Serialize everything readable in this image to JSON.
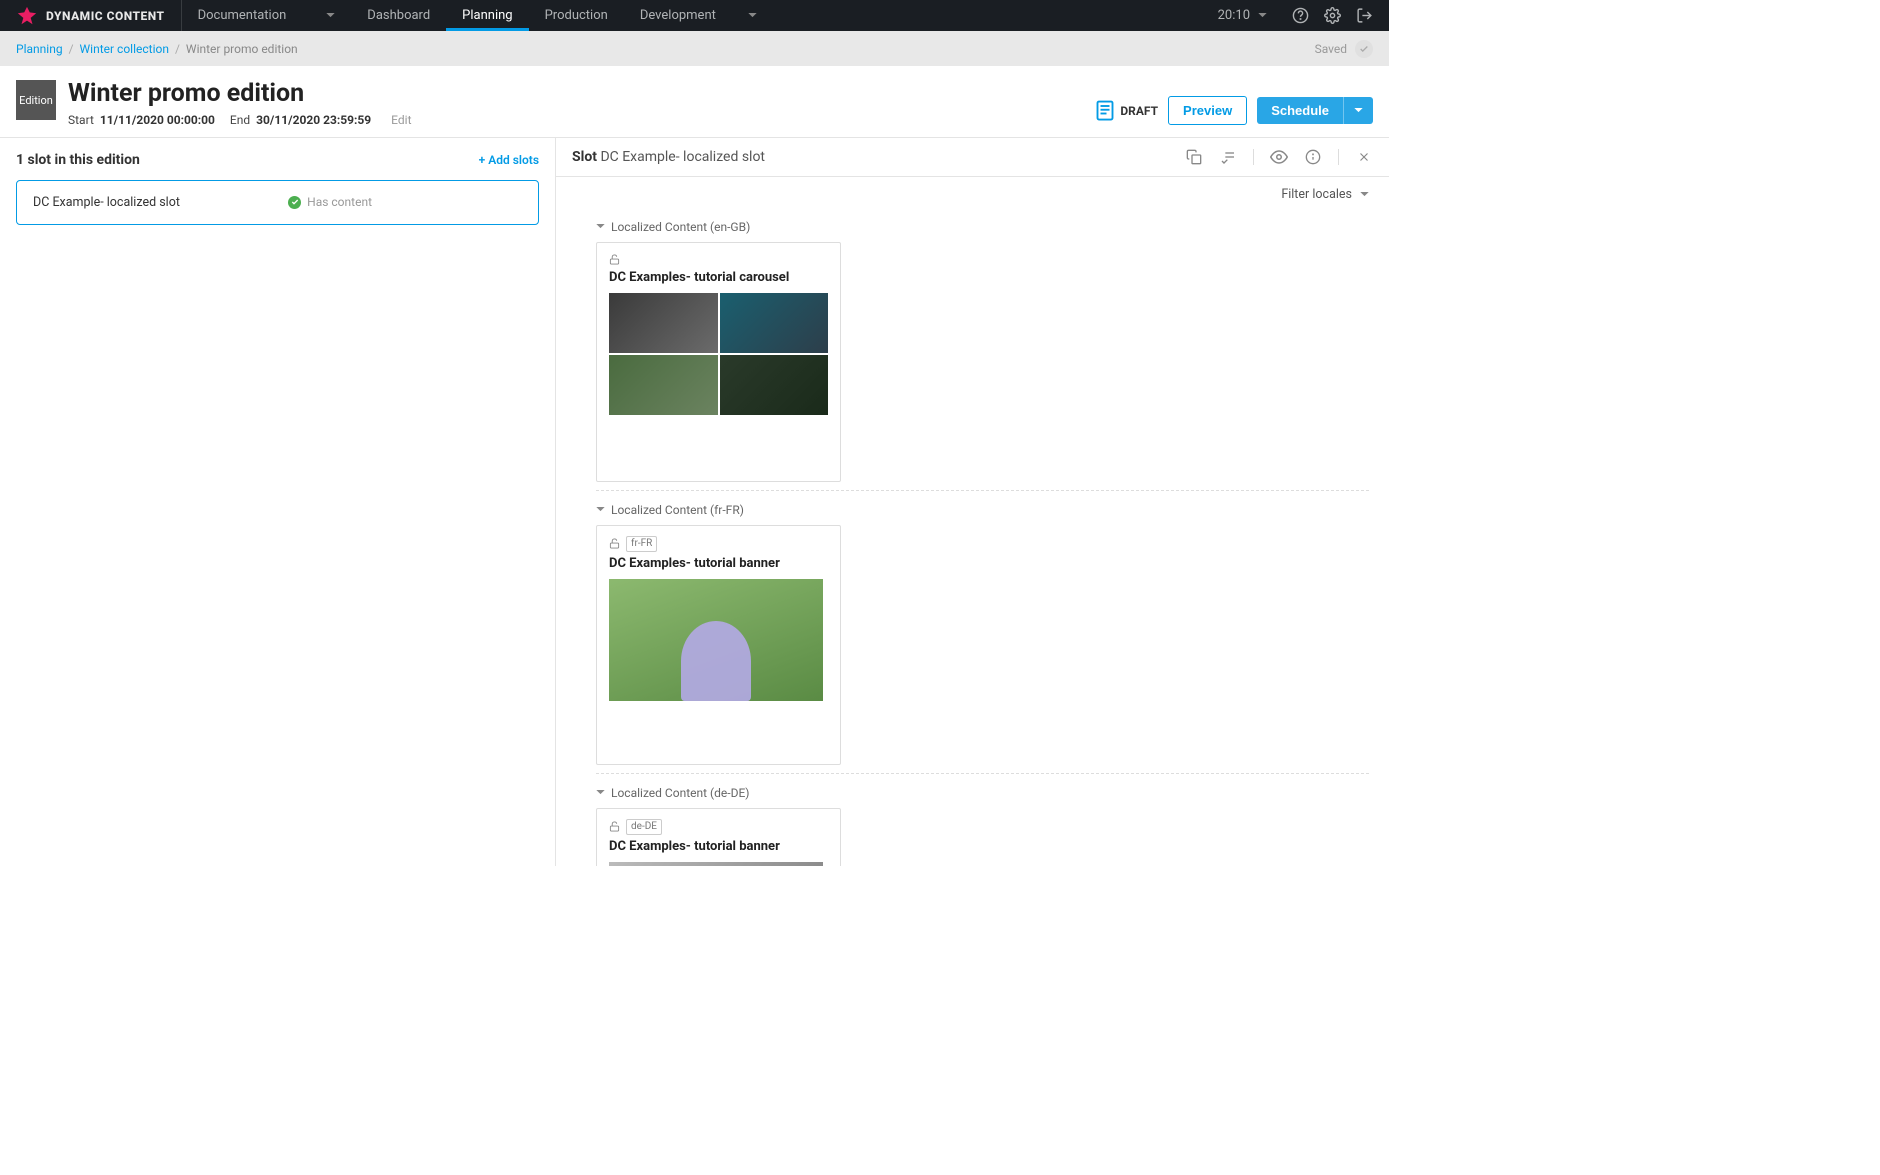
{
  "brand": "DYNAMIC CONTENT",
  "nav": {
    "dropdown": "Documentation",
    "tabs": [
      "Dashboard",
      "Planning",
      "Production",
      "Development"
    ],
    "active_tab": "Planning",
    "time": "20:10"
  },
  "breadcrumb": {
    "items": [
      "Planning",
      "Winter collection",
      "Winter promo edition"
    ],
    "saved_label": "Saved"
  },
  "edition": {
    "chip": "Edition",
    "title": "Winter promo edition",
    "start_label": "Start",
    "start_value": "11/11/2020 00:00:00",
    "end_label": "End",
    "end_value": "30/11/2020 23:59:59",
    "edit_label": "Edit",
    "status": "DRAFT",
    "preview_btn": "Preview",
    "schedule_btn": "Schedule"
  },
  "slots": {
    "heading": "1 slot in this edition",
    "add_label": "+ Add slots",
    "items": [
      {
        "name": "DC Example- localized slot",
        "status": "Has content"
      }
    ]
  },
  "slot_detail": {
    "label": "Slot",
    "name": "DC Example- localized slot",
    "filter_label": "Filter locales",
    "sections": [
      {
        "label": "Localized Content (en-GB)",
        "card_title": "DC Examples- tutorial carousel",
        "locale_tag": "",
        "type": "carousel"
      },
      {
        "label": "Localized Content (fr-FR)",
        "card_title": "DC Examples- tutorial banner",
        "locale_tag": "fr-FR",
        "type": "banner"
      },
      {
        "label": "Localized Content (de-DE)",
        "card_title": "DC Examples- tutorial banner",
        "locale_tag": "de-DE",
        "type": "banner"
      }
    ]
  }
}
